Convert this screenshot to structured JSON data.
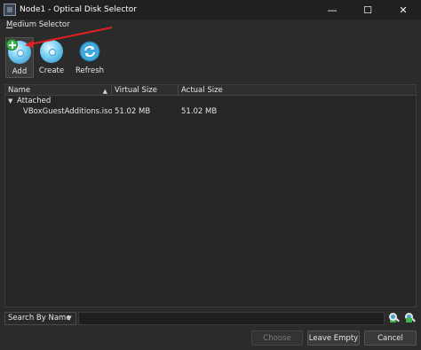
{
  "window": {
    "title": "Node1 - Optical Disk Selector",
    "minimize": "—",
    "maximize": "☐",
    "close": "✕"
  },
  "menu": {
    "label_u": "M",
    "label_rest": "edium Selector"
  },
  "toolbar": {
    "add_label": "Add",
    "create_label": "Create",
    "refresh_label": "Refresh"
  },
  "table": {
    "columns": [
      "Name",
      "Virtual Size",
      "Actual Size"
    ],
    "groups": [
      {
        "label": "Attached",
        "rows": [
          {
            "name": "VBoxGuestAdditions.iso",
            "virtual_size": "51.02 MB",
            "actual_size": "51.02 MB"
          }
        ]
      }
    ]
  },
  "search": {
    "mode": "Search By Name"
  },
  "buttons": {
    "choose_label": "Choose",
    "leave_empty_label": "Leave Empty",
    "cancel_label": "Cancel"
  },
  "colors": {
    "background": "#2b2b2b",
    "titlebar": "#202020",
    "annotation_arrow": "#e02020"
  }
}
